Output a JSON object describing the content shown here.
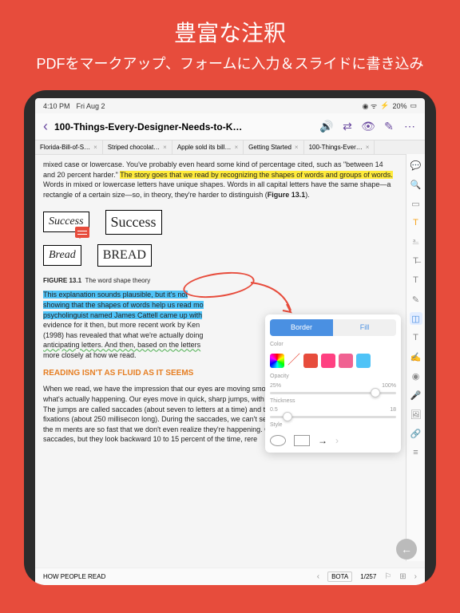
{
  "promo": {
    "title": "豊富な注釈",
    "subtitle": "PDFをマークアップ、フォームに入力＆スライドに書き込み"
  },
  "status": {
    "time": "4:10 PM",
    "date": "Fri Aug 2",
    "battery": "20%",
    "charging": "⚡"
  },
  "header": {
    "title": "100-Things-Every-Designer-Needs-to-K…"
  },
  "tabs": [
    {
      "label": "Florida-Bill-of-S…"
    },
    {
      "label": "Striped chocolat…"
    },
    {
      "label": "Apple sold its bill…"
    },
    {
      "label": "Getting Started"
    },
    {
      "label": "100-Things-Ever…"
    }
  ],
  "content": {
    "para1_a": "mixed case or lowercase. You've probably even heard some kind of percentage cited, such as \"between 14 and 20 percent harder.\" ",
    "para1_hl": "The story goes that we read by recognizing the shapes of words and groups of words.",
    "para1_b": " Words in mixed or lowercase letters have unique shapes. Words in all capital letters have the same shape—a rectangle of a certain size—so, in theory, they're harder to distinguish (",
    "para1_fig": "Figure 13.1",
    "para1_c": ").",
    "words": {
      "success_script": "Success",
      "success": "Success",
      "bread_script": "Bread",
      "bread_caps": "BREAD"
    },
    "figure": {
      "label": "FIGURE 13.1",
      "caption": "The word shape theory"
    },
    "para2_hl1": "This explanation sounds plausible, but it's not",
    "para2_hl2": "showing that the shapes of words help us read mo",
    "para2_hl3": "psycholinguist named James Cattell came up with",
    "para2_a": "evidence for it then, but more recent work by Ken",
    "para2_b": "(1998) has revealed that what we're actually doing",
    "para2_wavy": "anticipating letters. And then, based on the letters",
    "para2_c": "more closely at how we read.",
    "heading": "READING ISN'T AS FLUID AS IT SEEMS",
    "para3": "When we read, we have the impression that our eyes are moving smoothly across the page, but that's not what's actually happening. Our eyes move in quick, sharp jumps, with short periods of stillness in between. The jumps are called saccades (about seven to letters at a time) and the moments of stillness are called fixations (about 250 millisecon long). During the saccades, we can't see anything—we're essentially blind—but the m ments are so fast that we don't even realize they're happening. Our eyes look forward during most of the saccades, but they look backward 10 to 15 percent of the time, rere"
  },
  "popup": {
    "tab_border": "Border",
    "tab_fill": "Fill",
    "label_color": "Color",
    "label_opacity": "Opacity",
    "opacity_min": "25%",
    "opacity_max": "100%",
    "label_thickness": "Thickness",
    "thickness_min": "0.5",
    "thickness_max": "18",
    "label_style": "Style",
    "colors": [
      "#e74c3c",
      "#e74c3c",
      "#ff4081",
      "#ff4081",
      "#4fc3f7"
    ]
  },
  "bottom": {
    "section": "HOW PEOPLE READ",
    "bota": "BOTA",
    "page": "1/257"
  }
}
